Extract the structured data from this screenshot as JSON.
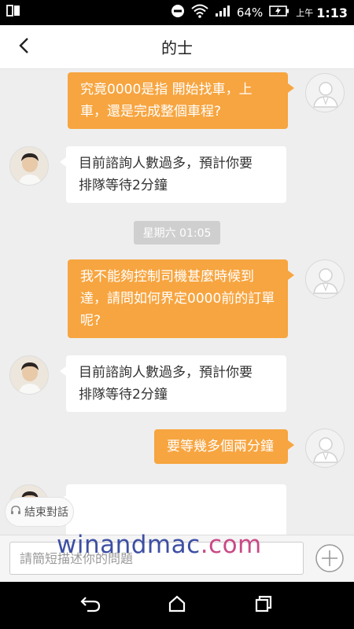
{
  "status_bar": {
    "battery": "64%",
    "ampm": "上午",
    "time": "1:13",
    "icons": [
      "sim-icon",
      "dnd-icon",
      "wifi-icon",
      "signal-icon",
      "battery-icon"
    ]
  },
  "header": {
    "title": "的士"
  },
  "chat": {
    "messages": [
      {
        "side": "out",
        "lines": [
          "究竟0000是指 開始找車，上",
          "車，還是完成整個車程?"
        ]
      },
      {
        "side": "in",
        "lines": [
          "目前諮詢人數過多，預計你要",
          "排隊等待2分鐘"
        ]
      },
      {
        "side": "out",
        "lines": [
          "我不能夠控制司機甚麼時候到",
          "達，請問如何界定0000前的訂單",
          "呢?"
        ]
      },
      {
        "side": "in",
        "lines": [
          "目前諮詢人數過多，預計你要",
          "排隊等待2分鐘"
        ]
      },
      {
        "side": "out",
        "lines": [
          "要等幾多個兩分鐘"
        ]
      }
    ],
    "timestamp": "星期六 01:05",
    "end_chat_label": "結束對話"
  },
  "input": {
    "placeholder": "請簡短描述你的問題"
  },
  "watermark": {
    "part1": "winandmac",
    "part2": ".com"
  },
  "colors": {
    "outgoing_bubble": "#f7a540",
    "incoming_bubble": "#ffffff",
    "chat_background": "#eeeeee"
  }
}
